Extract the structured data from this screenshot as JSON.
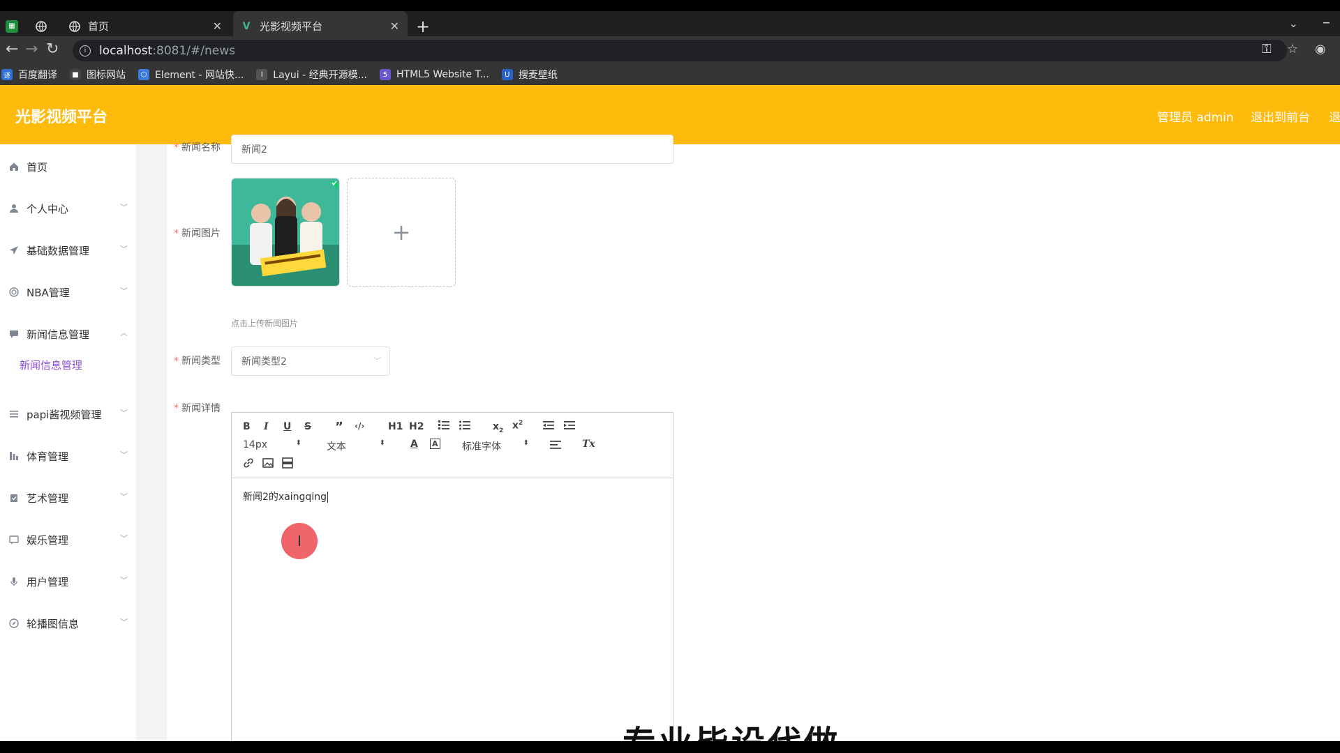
{
  "browser": {
    "tabs": [
      {
        "label": "首页"
      },
      {
        "label": "光影视频平台"
      }
    ],
    "url_host": "localhost",
    "url_path": ":8081/#/news",
    "bookmarks": [
      {
        "label": "百度翻译",
        "color": "#2f6fd6"
      },
      {
        "label": "图标网站",
        "color": "#444444"
      },
      {
        "label": "Element - 网站快...",
        "color": "#3b7dd8"
      },
      {
        "label": "Layui - 经典开源模...",
        "color": "#555555"
      },
      {
        "label": "HTML5 Website T...",
        "color": "#6a5acd"
      },
      {
        "label": "搜麦壁纸",
        "color": "#2a62c9"
      }
    ]
  },
  "app": {
    "brand": "光影视频平台",
    "accent": "#ffbb0c",
    "header_links": {
      "user": "管理员 admin",
      "front": "退出到前台",
      "logout": "退"
    }
  },
  "sidebar": {
    "items": [
      {
        "label": "首页",
        "icon": "home-icon"
      },
      {
        "label": "个人中心",
        "icon": "user-icon"
      },
      {
        "label": "基础数据管理",
        "icon": "send-icon"
      },
      {
        "label": "NBA管理",
        "icon": "circle-icon"
      },
      {
        "label": "新闻信息管理",
        "icon": "chat-icon"
      },
      {
        "label": "papi酱视频管理",
        "icon": "list-icon"
      },
      {
        "label": "体育管理",
        "icon": "chart-icon"
      },
      {
        "label": "艺术管理",
        "icon": "clipboard-icon"
      },
      {
        "label": "娱乐管理",
        "icon": "message-icon"
      },
      {
        "label": "用户管理",
        "icon": "mic-icon"
      },
      {
        "label": "轮播图信息",
        "icon": "compass-icon"
      }
    ],
    "submenu_active": "新闻信息管理"
  },
  "form": {
    "name_label": "新闻名称",
    "name_value": "新闻2",
    "image_label": "新闻图片",
    "image_hint": "点击上传新闻图片",
    "type_label": "新闻类型",
    "type_value": "新闻类型2",
    "detail_label": "新闻详情",
    "detail_text": "新闻2的xaingqing"
  },
  "editor_toolbar": {
    "h1": "H1",
    "h2": "H2",
    "size": "14px",
    "block": "文本",
    "font": "标准字体",
    "text_color": "A",
    "bg_color": "A",
    "clear": "Tx"
  },
  "overlay_subtitle": "专业毕设代做"
}
